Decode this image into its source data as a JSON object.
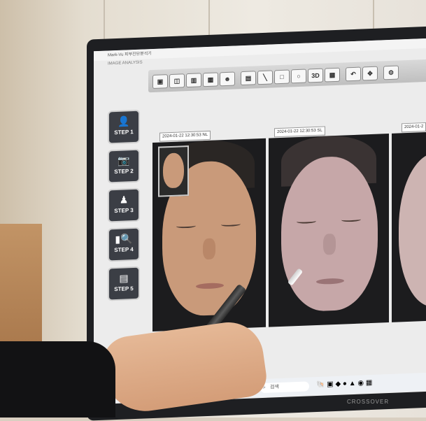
{
  "window": {
    "title": "Mark-Vu  피부진단분석기",
    "subtitle": "IMAGE ANALYSIS"
  },
  "steps": [
    {
      "label": "STEP 1",
      "icon": "user-add-icon"
    },
    {
      "label": "STEP 2",
      "icon": "camera-icon"
    },
    {
      "label": "STEP 3",
      "icon": "person-icon"
    },
    {
      "label": "STEP 4",
      "icon": "analysis-icon"
    },
    {
      "label": "STEP 5",
      "icon": "report-icon"
    }
  ],
  "toolbar": {
    "three_d_label": "3D"
  },
  "photos": [
    {
      "date": "2024-01-22 12:30:53",
      "mode": "NL"
    },
    {
      "date": "2024-01-22 12:30:53",
      "mode": "SL"
    },
    {
      "date": "2024-01-2"
    }
  ],
  "taskbar": {
    "search_placeholder": "검색"
  },
  "monitor": {
    "brand": "CROSSOVER"
  }
}
